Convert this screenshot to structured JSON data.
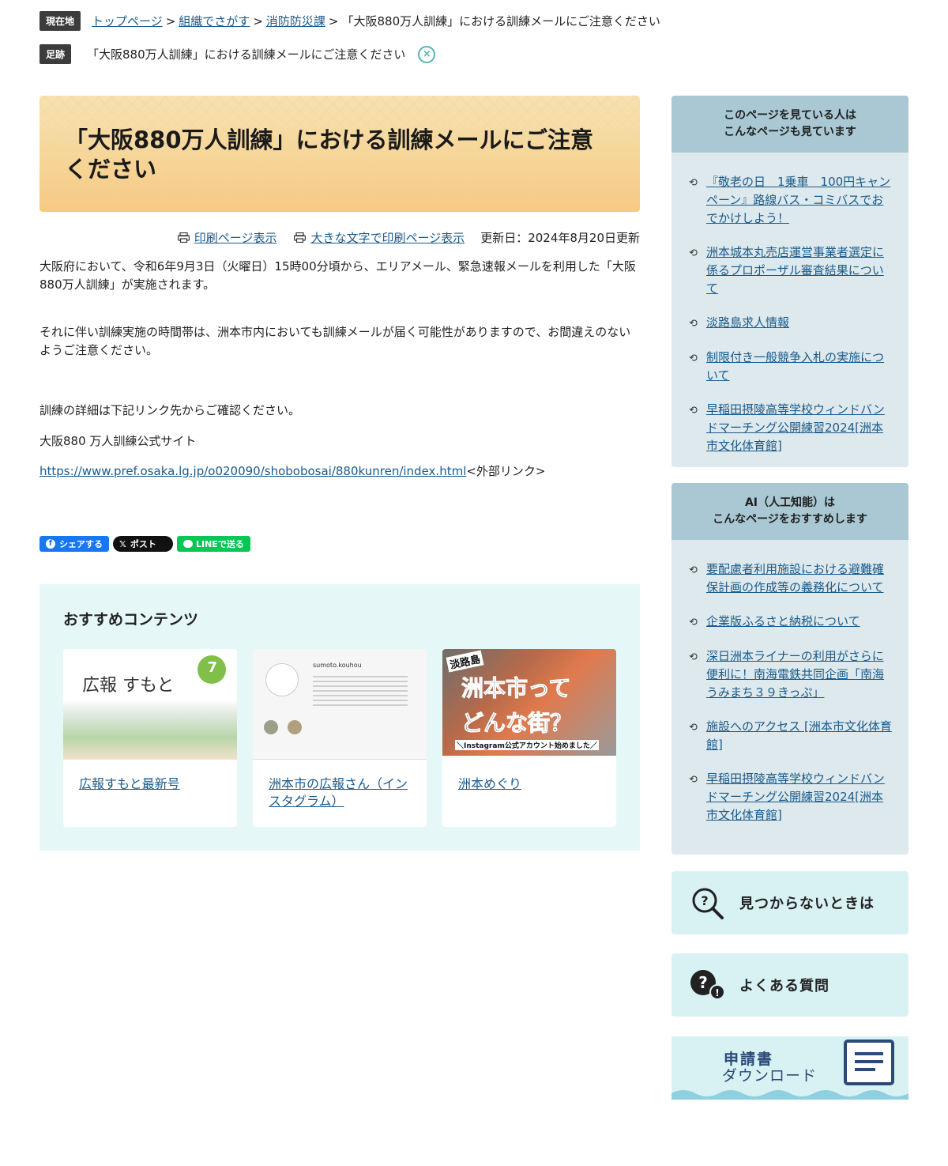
{
  "breadcrumb": {
    "badge": "現在地",
    "items": [
      "トップページ",
      "組織でさがす",
      "消防防災課"
    ],
    "sep": ">",
    "current": "「大阪880万人訓練」における訓練メールにご注意ください"
  },
  "footprint": {
    "badge": "足跡",
    "item": "「大阪880万人訓練」における訓練メールにご注意ください",
    "close_icon": "×"
  },
  "article": {
    "title": "「大阪880万人訓練」における訓練メールにご注意ください",
    "print_label": "印刷ページ表示",
    "large_print_label": "大きな文字で印刷ページ表示",
    "updated": "更新日：2024年8月20日更新",
    "p1": "大阪府において、令和6年9月3日（火曜日）15時00分頃から、エリアメール、緊急速報メールを利用した「大阪880万人訓練」が実施されます。",
    "p2": "それに伴い訓練実施の時間帯は、洲本市内においても訓練メールが届く可能性がありますので、お間違えのないようご注意ください。",
    "p3": "訓練の詳細は下記リンク先からご確認ください。",
    "p4": "大阪880 万人訓練公式サイト",
    "link": "https://www.pref.osaka.lg.jp/o020090/shobobosai/880kunren/index.html",
    "link_suffix": "<外部リンク>"
  },
  "share": {
    "facebook": "シェアする",
    "x": "ポスト",
    "line": "LINEで送る"
  },
  "recommended": {
    "title": "おすすめコンテンツ",
    "cards": [
      {
        "label": "広報すもと最新号",
        "thumb_text": "広報 すもと",
        "thumb_badge": "7"
      },
      {
        "label": "洲本市の広報さん（インスタグラム）",
        "thumb_text": "sumoto.kouhou"
      },
      {
        "label": "洲本めぐり",
        "thumb_text_1": "淡路島",
        "thumb_text_2": "洲本市って",
        "thumb_text_3": "どんな街？",
        "thumb_text_4": "＼Instagram公式アカウント始めました／"
      }
    ]
  },
  "sidebar": {
    "viewed": {
      "title_1": "このページを見ている人は",
      "title_2": "こんなページも見ています",
      "items": [
        "『敬老の日　1乗車　100円キャンペーン』路線バス・コミバスでおでかけしよう！",
        "洲本城本丸売店運営事業者選定に係るプロポーザル審査結果について",
        "淡路島求人情報",
        "制限付き一般競争入札の実施について",
        "早稲田摂陵高等学校ウィンドバンドマーチング公開練習2024[洲本市文化体育館]"
      ]
    },
    "ai": {
      "title_1": "AI（人工知能）は",
      "title_2": "こんなページをおすすめします",
      "items": [
        "要配慮者利用施設における避難確保計画の作成等の義務化について",
        "企業版ふるさと納税について",
        "深日洲本ライナーの利用がさらに便利に！南海電鉄共同企画「南海うみまち３９きっぷ」",
        "施設へのアクセス [洲本市文化体育館]",
        "早稲田摂陵高等学校ウィンドバンドマーチング公開練習2024[洲本市文化体育館]"
      ]
    },
    "not_found": "見つからないときは",
    "faq": "よくある質問",
    "download_1": "申請書",
    "download_2": "ダウンロード"
  }
}
